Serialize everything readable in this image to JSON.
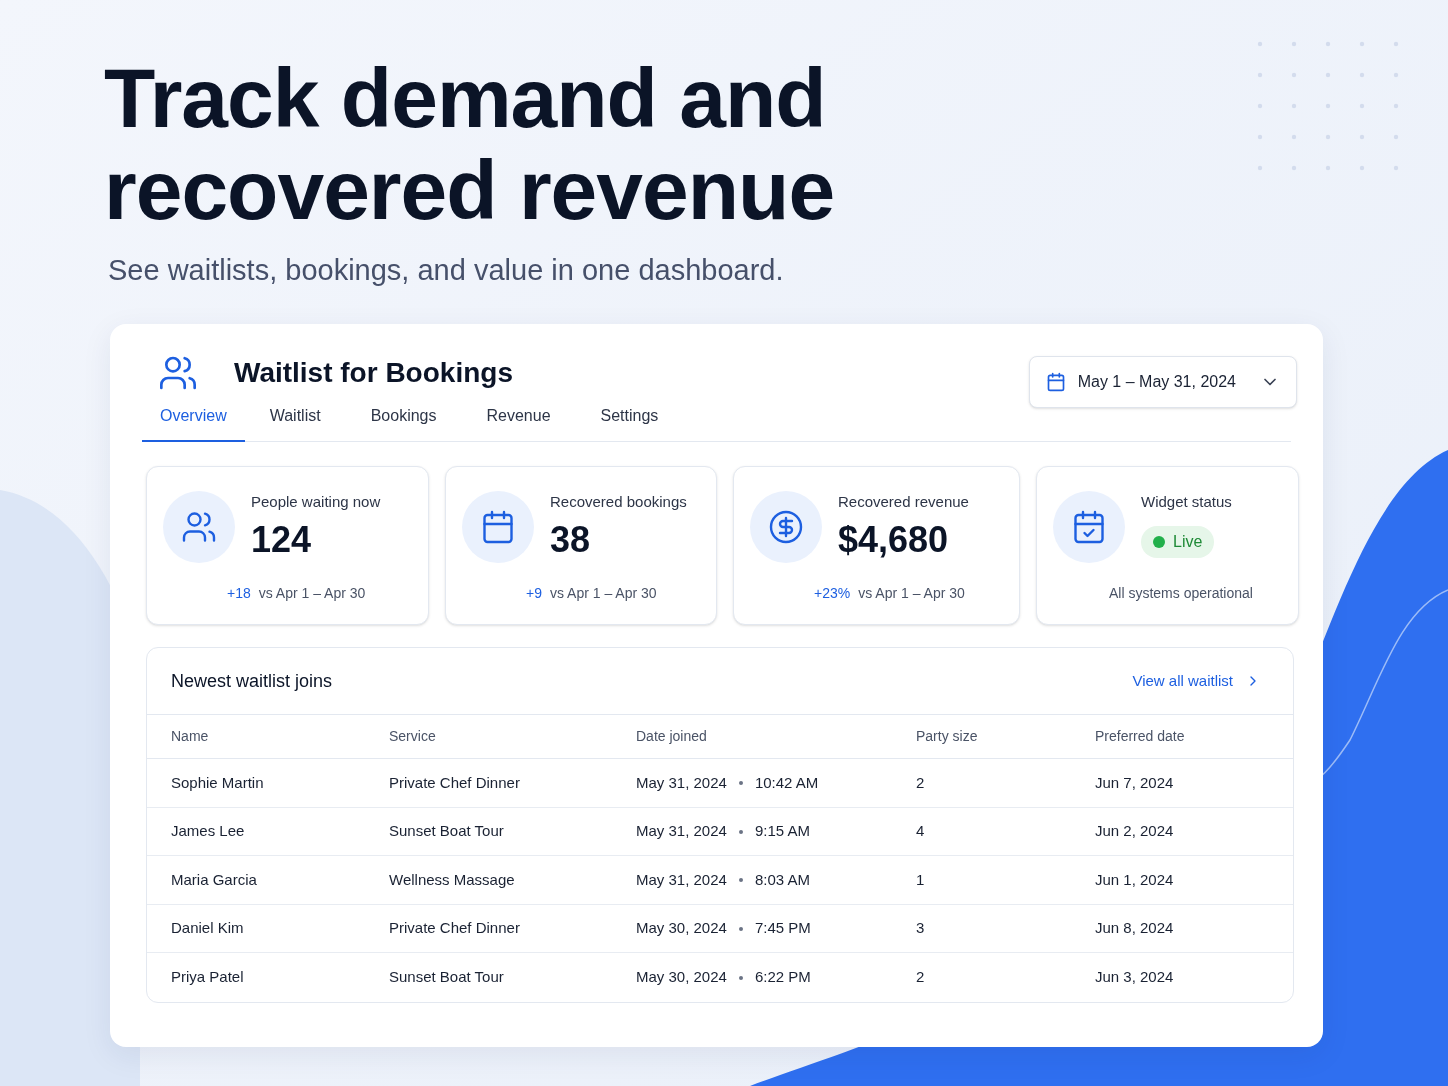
{
  "hero": {
    "title": "Track demand and recovered revenue",
    "subtitle": "See waitlists, bookings, and value in one dashboard."
  },
  "app": {
    "title": "Waitlist for Bookings",
    "date_range": "May 1 – May 31, 2024",
    "tabs": [
      {
        "label": "Overview",
        "selected": true
      },
      {
        "label": "Waitlist",
        "selected": false
      },
      {
        "label": "Bookings",
        "selected": false
      },
      {
        "label": "Revenue",
        "selected": false
      },
      {
        "label": "Settings",
        "selected": false
      }
    ],
    "stats": [
      {
        "kind": "people",
        "label": "People waiting now",
        "value": "124",
        "delta": "+18",
        "comparison": "vs Apr 1 – Apr 30"
      },
      {
        "kind": "calendar",
        "label": "Recovered bookings",
        "value": "38",
        "delta": "+9",
        "comparison": "vs Apr 1 – Apr 30"
      },
      {
        "kind": "dollar",
        "label": "Recovered revenue",
        "value": "$4,680",
        "delta": "+23%",
        "comparison": "vs Apr 1 – Apr 30"
      },
      {
        "kind": "status",
        "label": "Widget status",
        "badge": "Live",
        "note": "All systems operational"
      }
    ],
    "table": {
      "title": "Newest waitlist joins",
      "link": "View all waitlist",
      "columns": [
        "Name",
        "Service",
        "Date joined",
        "Party size",
        "Preferred date"
      ],
      "rows": [
        {
          "name": "Sophie Martin",
          "service": "Private Chef Dinner",
          "date": "May 31, 2024",
          "time": "10:42 AM",
          "party": "2",
          "preferred": "Jun 7, 2024"
        },
        {
          "name": "James Lee",
          "service": "Sunset Boat Tour",
          "date": "May 31, 2024",
          "time": "9:15 AM",
          "party": "4",
          "preferred": "Jun 2, 2024"
        },
        {
          "name": "Maria Garcia",
          "service": "Wellness Massage",
          "date": "May 31, 2024",
          "time": "8:03 AM",
          "party": "1",
          "preferred": "Jun 1, 2024"
        },
        {
          "name": "Daniel Kim",
          "service": "Private Chef Dinner",
          "date": "May 30, 2024",
          "time": "7:45 PM",
          "party": "3",
          "preferred": "Jun 8, 2024"
        },
        {
          "name": "Priya Patel",
          "service": "Sunset Boat Tour",
          "date": "May 30, 2024",
          "time": "6:22 PM",
          "party": "2",
          "preferred": "Jun 3, 2024"
        }
      ]
    }
  }
}
